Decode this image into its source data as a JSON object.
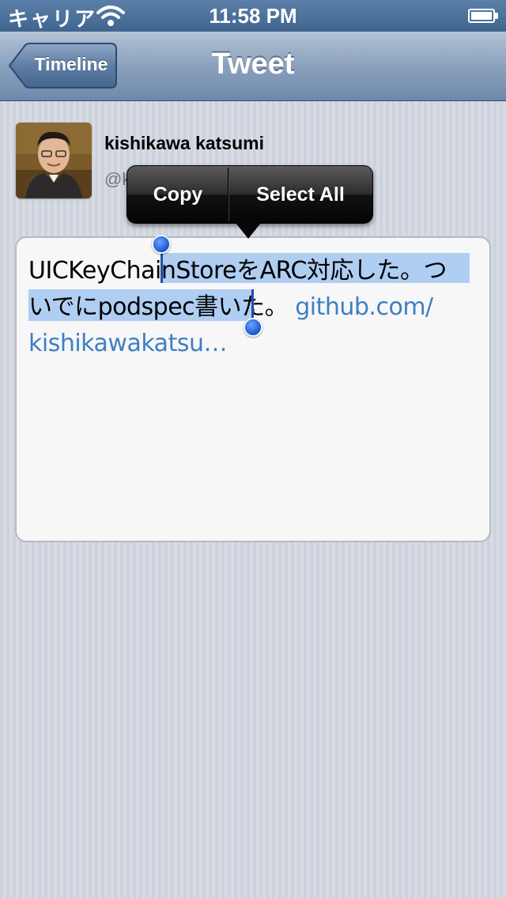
{
  "status_bar": {
    "carrier": "キャリア",
    "time": "11:58 PM"
  },
  "nav_bar": {
    "back_label": "Timeline",
    "title": "Tweet"
  },
  "user": {
    "name": "kishikawa katsumi",
    "handle_partial": "@k"
  },
  "tweet": {
    "line1_before": "UICKeyCha",
    "line1_selected": "inStoreをARC対応した。つ",
    "line2_selected": "いでにpodspec書い",
    "line2_after": "た。 ",
    "link_part1": "github.com/",
    "link_part2": "kishikawakatsu…"
  },
  "edit_menu": {
    "copy_label": "Copy",
    "select_all_label": "Select All"
  },
  "colors": {
    "selection": "#b0cdf2",
    "link": "#3f7fc4",
    "nav_text": "#ffffff"
  }
}
